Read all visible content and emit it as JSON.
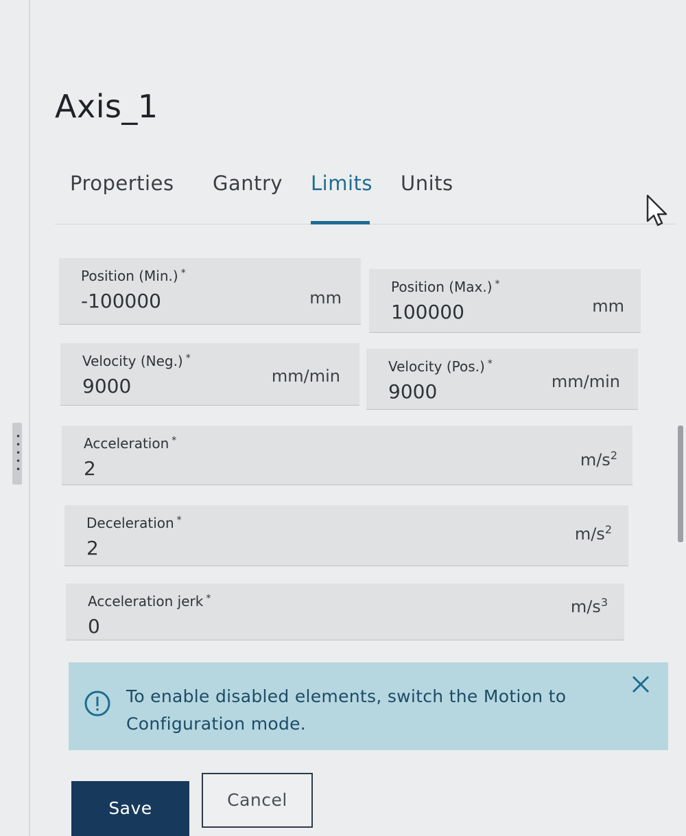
{
  "panel": {
    "title": "Axis_1"
  },
  "tabs": [
    {
      "label": "Properties",
      "active": false
    },
    {
      "label": "Gantry",
      "active": false
    },
    {
      "label": "Limits",
      "active": true
    },
    {
      "label": "Units",
      "active": false
    }
  ],
  "fields": {
    "position_min": {
      "label": "Position (Min.)",
      "required": "*",
      "value": "-100000",
      "unit": "mm"
    },
    "position_max": {
      "label": "Position (Max.)",
      "required": "*",
      "value": "100000",
      "unit": "mm"
    },
    "velocity_neg": {
      "label": "Velocity (Neg.)",
      "required": "*",
      "value": "9000",
      "unit": "mm/min"
    },
    "velocity_pos": {
      "label": "Velocity (Pos.)",
      "required": "*",
      "value": "9000",
      "unit": "mm/min"
    },
    "acceleration": {
      "label": "Acceleration",
      "required": "*",
      "value": "2",
      "unit_base": "m/s",
      "unit_exp": "2"
    },
    "deceleration": {
      "label": "Deceleration",
      "required": "*",
      "value": "2",
      "unit_base": "m/s",
      "unit_exp": "2"
    },
    "acceleration_jerk": {
      "label": "Acceleration jerk",
      "required": "*",
      "value": "0",
      "unit_base": "m/s",
      "unit_exp": "3"
    }
  },
  "banner": {
    "message": "To enable disabled elements, switch the Motion to Configuration mode.",
    "icon": "info-circle-icon",
    "close_icon": "close-icon"
  },
  "actions": {
    "save_label": "Save",
    "cancel_label": "Cancel"
  },
  "colors": {
    "accent": "#1d6d92",
    "primary_button": "#173a5c",
    "banner_bg": "#b6d7e0"
  }
}
